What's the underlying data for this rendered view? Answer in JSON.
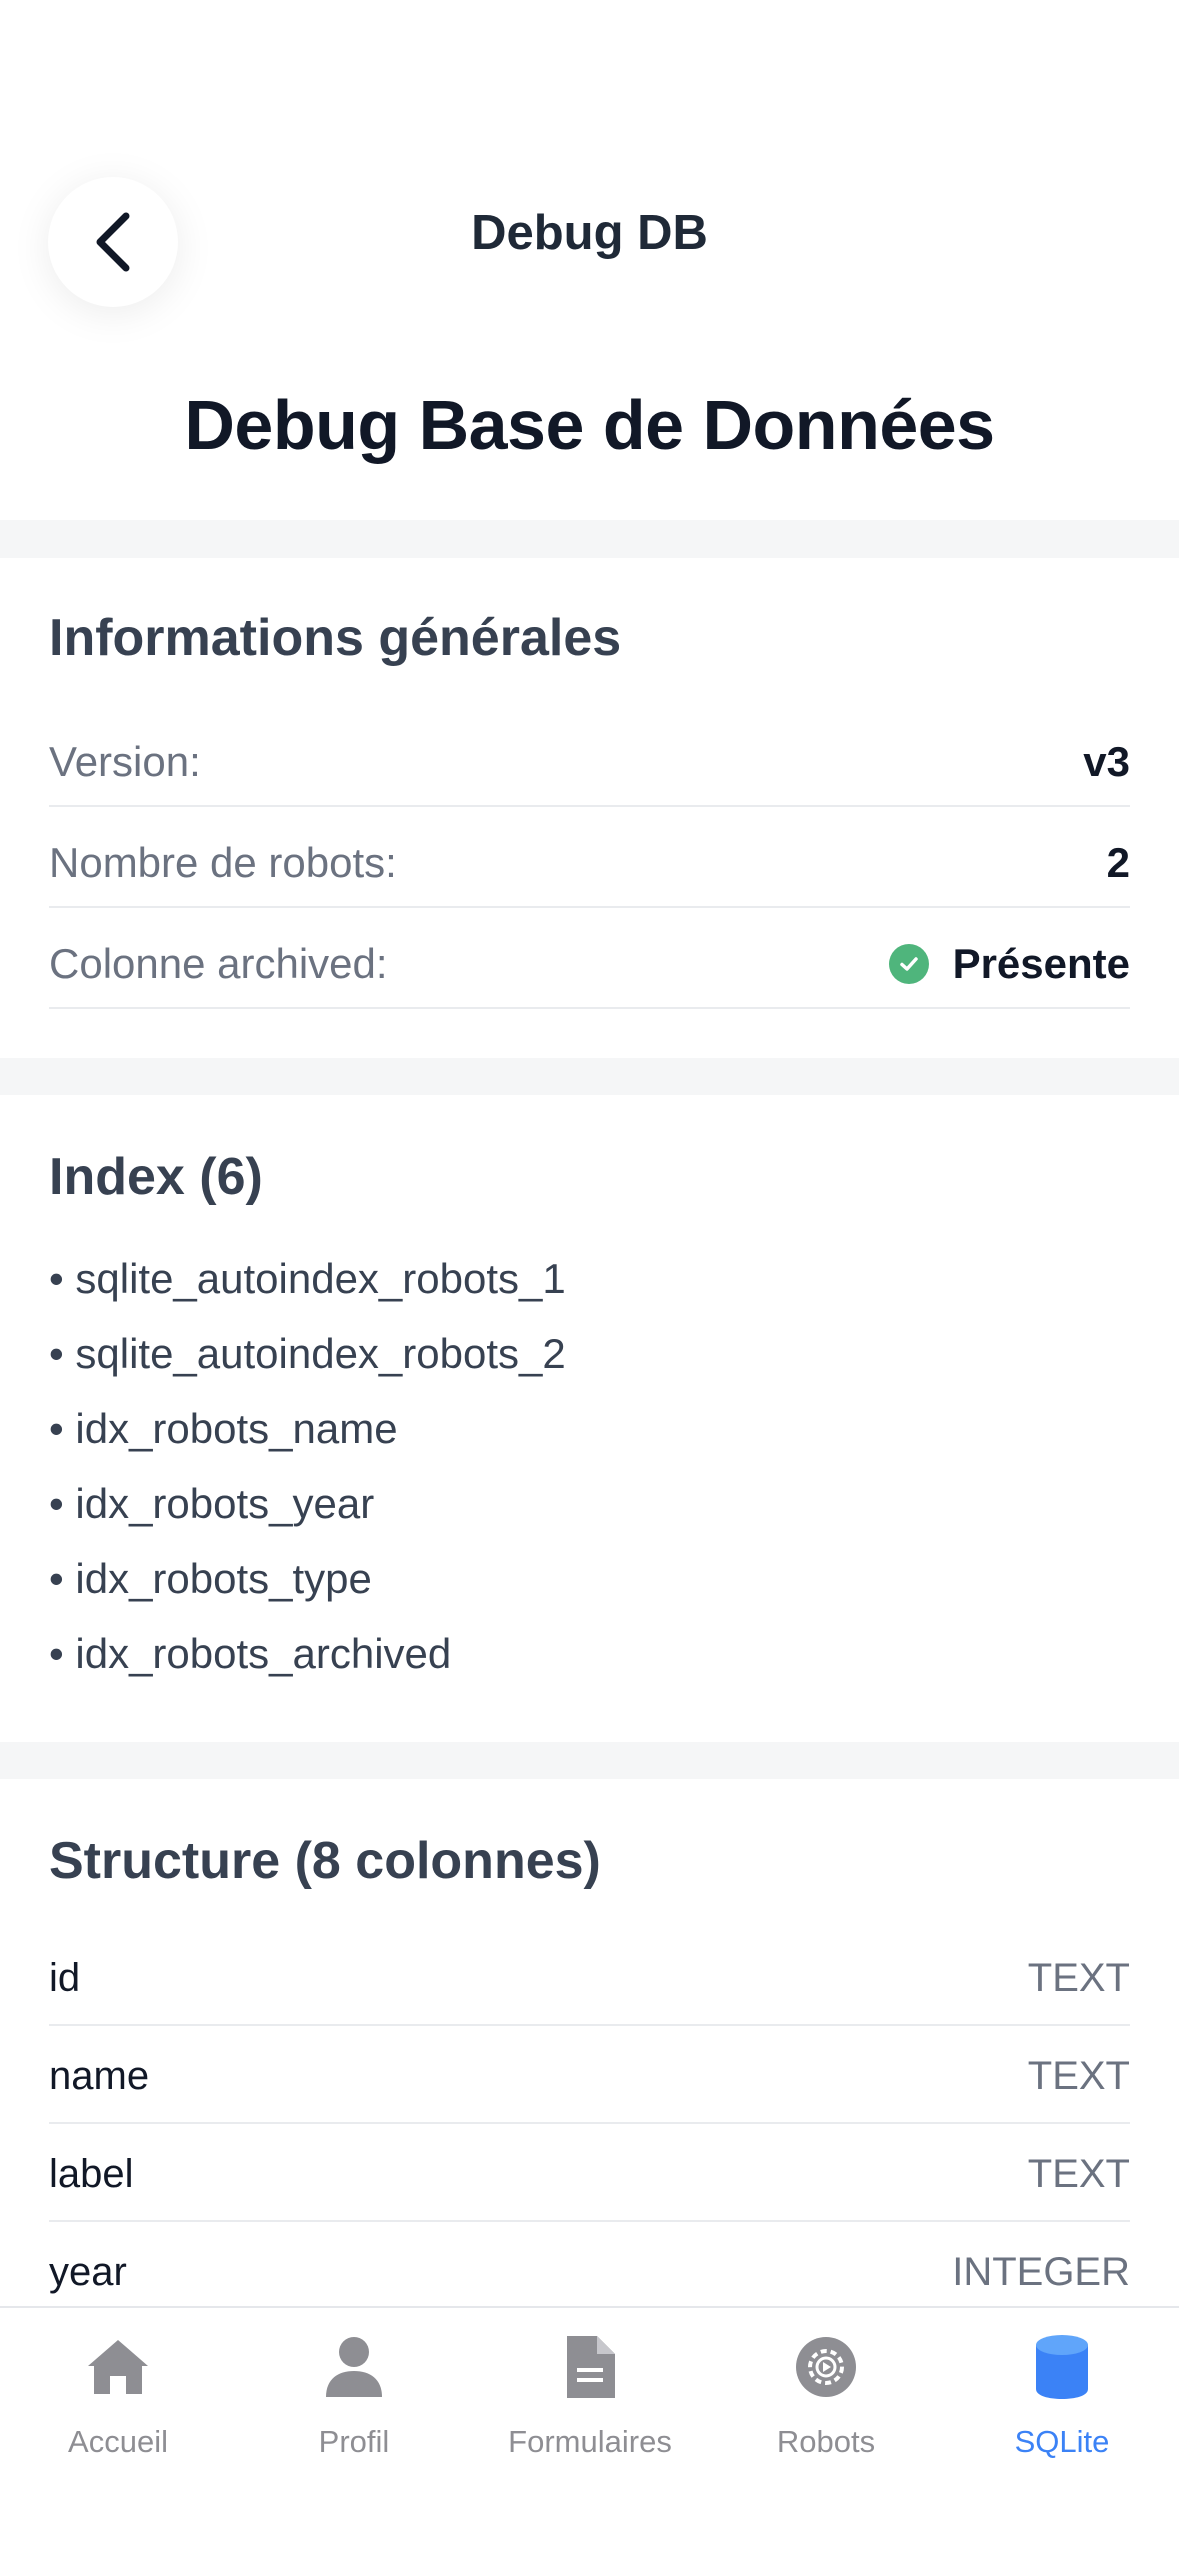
{
  "header": {
    "nav_title": "Debug DB",
    "page_title": "Debug Base de Données"
  },
  "general_info": {
    "title": "Informations générales",
    "rows": [
      {
        "label": "Version:",
        "value": "v3"
      },
      {
        "label": "Nombre de robots:",
        "value": "2"
      },
      {
        "label": "Colonne archived:",
        "value": "Présente",
        "status_icon": "check-circle-icon",
        "status_color": "#4fb57c"
      }
    ]
  },
  "indexes": {
    "title": "Index (6)",
    "items": [
      "• sqlite_autoindex_robots_1",
      "• sqlite_autoindex_robots_2",
      "• idx_robots_name",
      "• idx_robots_year",
      "• idx_robots_type",
      "• idx_robots_archived"
    ]
  },
  "structure": {
    "title": "Structure (8 colonnes)",
    "columns": [
      {
        "name": "id",
        "type": "TEXT"
      },
      {
        "name": "name",
        "type": "TEXT"
      },
      {
        "name": "label",
        "type": "TEXT"
      },
      {
        "name": "year",
        "type": "INTEGER"
      }
    ]
  },
  "tabbar": {
    "active_color": "#3b82f6",
    "inactive_color": "#8e8e93",
    "tabs": [
      {
        "label": "Accueil",
        "icon": "home-icon"
      },
      {
        "label": "Profil",
        "icon": "person-icon"
      },
      {
        "label": "Formulaires",
        "icon": "document-icon"
      },
      {
        "label": "Robots",
        "icon": "robot-gear-icon"
      },
      {
        "label": "SQLite",
        "icon": "database-icon",
        "active": true
      }
    ]
  }
}
